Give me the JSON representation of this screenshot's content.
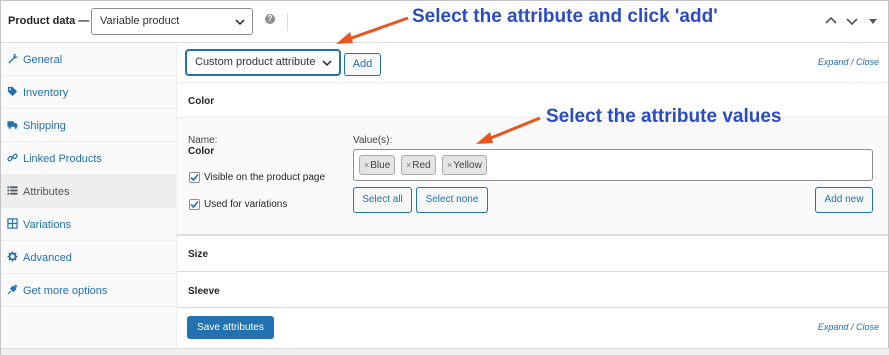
{
  "header": {
    "title": "Product data —",
    "product_type": "Variable product",
    "help_icon": "question-circle-icon",
    "collapse_icons": [
      "chevron-up-icon",
      "chevron-down-icon",
      "triangle-down-icon"
    ]
  },
  "annotations": {
    "top": "Select the attribute and click 'add'",
    "middle": "Select the attribute values",
    "arrow_color": "#e8561e",
    "text_color": "#2a4dc4"
  },
  "sidebar": {
    "items": [
      {
        "label": "General",
        "icon": "wrench-icon",
        "active": false
      },
      {
        "label": "Inventory",
        "icon": "tag-icon",
        "active": false
      },
      {
        "label": "Shipping",
        "icon": "truck-icon",
        "active": false
      },
      {
        "label": "Linked Products",
        "icon": "link-icon",
        "active": false
      },
      {
        "label": "Attributes",
        "icon": "list-icon",
        "active": true
      },
      {
        "label": "Variations",
        "icon": "grid-icon",
        "active": false
      },
      {
        "label": "Advanced",
        "icon": "gear-icon",
        "active": false
      },
      {
        "label": "Get more options",
        "icon": "plug-icon",
        "active": false
      }
    ]
  },
  "toolbar": {
    "attribute_select": "Custom product attribute",
    "add_label": "Add",
    "expand_label": "Expand",
    "separator": "/",
    "close_label": "Close"
  },
  "attributes": {
    "color": {
      "title": "Color",
      "name_label": "Name:",
      "name_value": "Color",
      "values_label": "Value(s):",
      "values": [
        "Blue",
        "Red",
        "Yellow"
      ],
      "tag_remove": "×",
      "visible_label": "Visible on the product page",
      "visible_checked": true,
      "variations_label": "Used for variations",
      "variations_checked": true,
      "select_all": "Select all",
      "select_none": "Select none",
      "add_new": "Add new"
    },
    "size": {
      "title": "Size"
    },
    "sleeve": {
      "title": "Sleeve"
    }
  },
  "footer": {
    "save_label": "Save attributes",
    "expand_label": "Expand",
    "separator": "/",
    "close_label": "Close"
  },
  "colors": {
    "accent": "#2271b1",
    "border": "#dcdcde"
  }
}
